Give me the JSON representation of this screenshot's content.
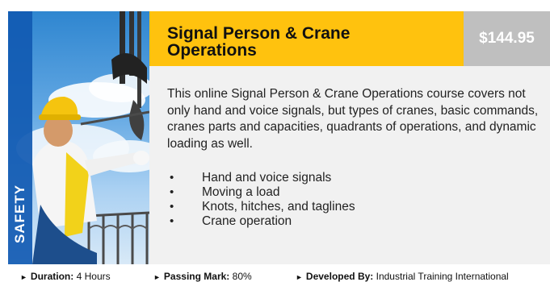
{
  "course": {
    "category": "SAFETY",
    "title": "Signal Person & Crane Operations",
    "price": "$144.95",
    "description": "This online Signal Person & Crane Operations course covers not only hand and voice signals, but types of cranes, basic commands, cranes parts and capacities, quadrants of operations, and dynamic loading as well.",
    "topics": [
      "Hand and voice signals",
      "Moving a load",
      "Knots, hitches, and taglines",
      "Crane operation"
    ]
  },
  "meta": {
    "marker": "►",
    "duration_label": "Duration:",
    "duration_value": "4 Hours",
    "passing_label": "Passing Mark:",
    "passing_value": "80%",
    "developer_label": "Developed By:",
    "developer_value": "Industrial Training International"
  },
  "colors": {
    "title_bar": "#ffc20e",
    "price_box": "#bfbfbf",
    "category_band": "#115ab2",
    "card_background": "#f1f1f1"
  }
}
